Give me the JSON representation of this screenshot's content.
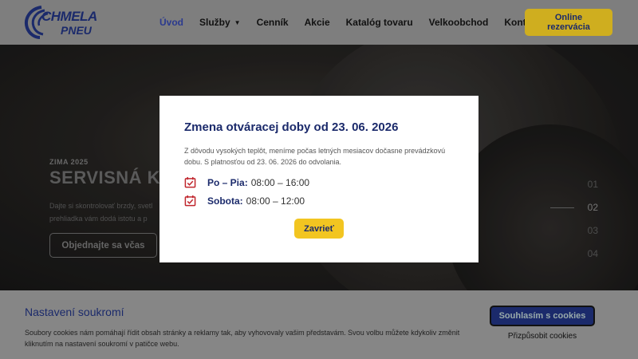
{
  "header": {
    "logo_line1": "CHMELA",
    "logo_line2": "PNEU",
    "nav": [
      {
        "label": "Úvod",
        "active": true
      },
      {
        "label": "Služby",
        "has_dropdown": true
      },
      {
        "label": "Cenník"
      },
      {
        "label": "Akcie"
      },
      {
        "label": "Katalóg tovaru"
      },
      {
        "label": "Velkoobchod"
      },
      {
        "label": "Kontakty"
      }
    ],
    "reserve_line1": "Online",
    "reserve_line2": "rezervácia"
  },
  "hero": {
    "tag": "ZIMA 2025",
    "title": "SERVISNÁ K",
    "desc_line1": "Dajte si skontrolovať brzdy, svetl",
    "desc_line2": "prehliadka vám dodá istotu a p",
    "button": "Objednajte sa včas",
    "slides": [
      "01",
      "02",
      "03",
      "04"
    ],
    "active_slide": "02"
  },
  "modal": {
    "title": "Zmena otváracej doby od 23. 06. 2026",
    "text": "Z dôvodu vysokých teplôt, meníme počas letných mesiacov dočasne prevádzkovú dobu. S platnosťou od 23. 06. 2026 do odvolania.",
    "hours": [
      {
        "label": "Po – Pia:",
        "value": "08:00 – 16:00"
      },
      {
        "label": "Sobota:",
        "value": "08:00 – 12:00"
      }
    ],
    "close": "Zavrieť"
  },
  "cookie": {
    "title": "Nastavení soukromí",
    "text": "Soubory cookies nám pomáhají řídit obsah stránky a reklamy tak, aby vyhovovaly vašim představám. Svou volbu můžete kdykoliv změnit kliknutím na nastavení soukromí v patičce webu.",
    "accept": "Souhlasím s cookies",
    "customize": "Přizpůsobit cookies"
  },
  "colors": {
    "brand_navy": "#1b2a6b",
    "accent_yellow": "#f2c521",
    "calendar_red": "#c0262d"
  }
}
